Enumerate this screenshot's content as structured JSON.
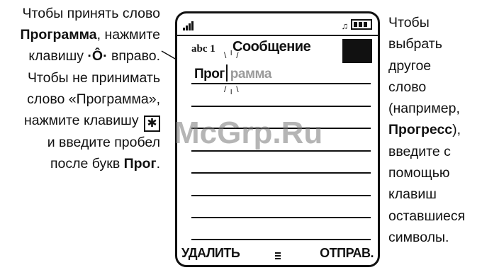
{
  "left_note": {
    "l1": "Чтобы принять слово",
    "l2_bold": "Программа",
    "l2_rest": ", нажмите",
    "l3_a": "клавишу",
    "l3_icon": "joystick-icon",
    "l3_b": "вправо.",
    "l4": "Чтобы не принимать",
    "l5": "слово «Программа»,",
    "l6": "нажмите клавишу",
    "l6_icon": "star-key-icon",
    "l7": "и введите пробел",
    "l8_a": "после букв",
    "l8_bold": "Прог",
    "l8_b": "."
  },
  "right_note": {
    "l1": "Чтобы",
    "l2": "выбрать",
    "l3": "другое",
    "l4": "слово",
    "l5": "(например,",
    "l6_bold": "Прогресс",
    "l6_rest": "),",
    "l7": "введите с",
    "l8": "помощью",
    "l9": "клавиш",
    "l10": "оставшиеся",
    "l11": "символы."
  },
  "screen": {
    "mode": "abc 1",
    "title": "Сообщение",
    "typed": "Прог",
    "completion": "рамма",
    "softkey_left": "УДАЛИТЬ",
    "softkey_right": "ОТПРАВ."
  },
  "watermark": "McGrp.Ru"
}
